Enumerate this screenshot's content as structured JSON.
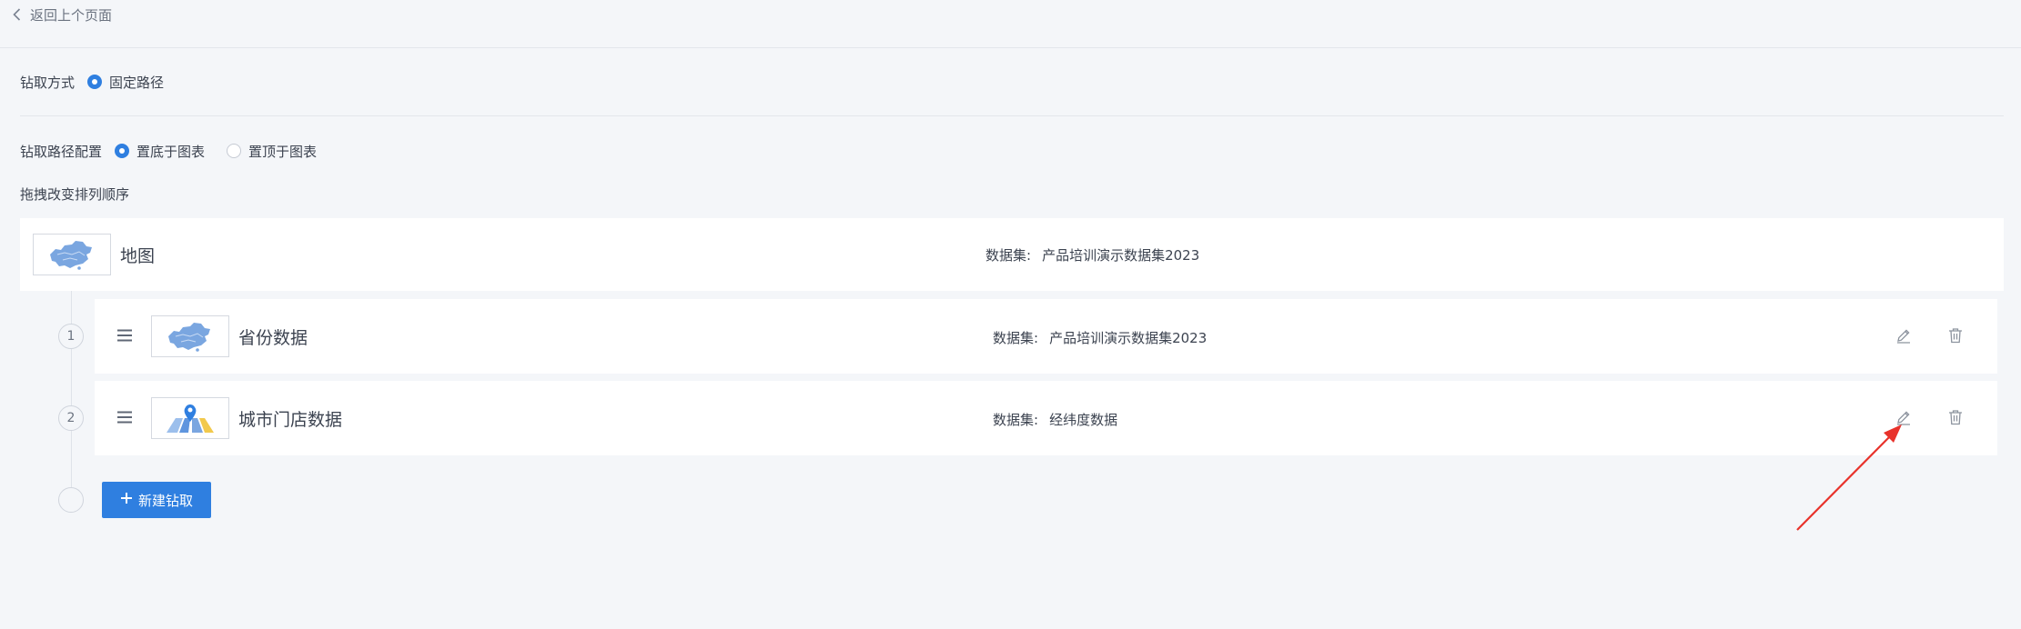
{
  "topbar": {
    "back_label": "返回上个页面",
    "back_icon": "chevron-left-icon"
  },
  "drill_mode": {
    "label": "钻取方式",
    "options": [
      {
        "label": "固定路径",
        "checked": true
      }
    ]
  },
  "path_config": {
    "label": "钻取路径配置",
    "options": [
      {
        "label": "置底于图表",
        "checked": true
      },
      {
        "label": "置顶于图表",
        "checked": false
      }
    ]
  },
  "sort_hint": "拖拽改变排列顺序",
  "root": {
    "name": "地图",
    "thumbnail": "china-map-thumbnail",
    "dataset_label": "数据集:",
    "dataset_value": "产品培训演示数据集2023"
  },
  "drill_items": [
    {
      "index": "1",
      "name": "省份数据",
      "thumbnail": "china-map-thumbnail",
      "dataset_label": "数据集:",
      "dataset_value": "产品培训演示数据集2023"
    },
    {
      "index": "2",
      "name": "城市门店数据",
      "thumbnail": "location-map-thumbnail",
      "dataset_label": "数据集:",
      "dataset_value": "经纬度数据"
    }
  ],
  "new_drill_button": {
    "label": "新建钻取",
    "icon": "plus-icon"
  },
  "colors": {
    "accent": "#2f7fe0",
    "annotation_arrow": "#e8322b",
    "background": "#f4f6f9"
  }
}
